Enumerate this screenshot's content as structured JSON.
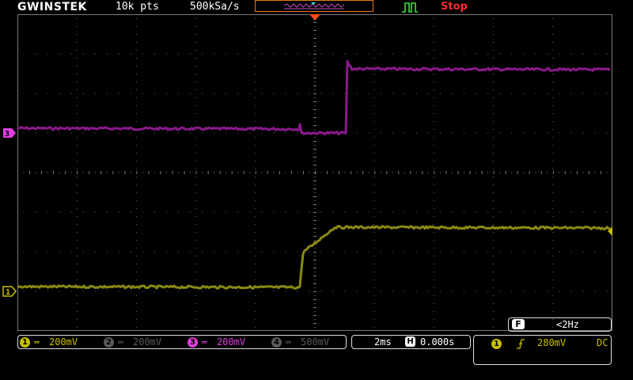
{
  "header": {
    "brand": "GWINSTEK",
    "record_length": "10k pts",
    "sample_rate": "500kSa/s",
    "acquisition_status": "Stop"
  },
  "colors": {
    "ch1": "#c8c000",
    "ch2": "#5a5a5a",
    "ch3": "#e040e0",
    "ch4": "#5a5a5a",
    "trace1": "#8a8a12",
    "trace3": "#8a1a8a",
    "status": "#ff2a2a",
    "accent": "#e57a1c",
    "trigger_icon": "#40e040"
  },
  "channels": [
    {
      "number": "1",
      "coupling": "═",
      "scale": "200mV",
      "active": true
    },
    {
      "number": "2",
      "coupling": "═",
      "scale": "200mV",
      "active": false
    },
    {
      "number": "3",
      "coupling": "═",
      "scale": "200mV",
      "active": true
    },
    {
      "number": "4",
      "coupling": "═",
      "scale": "500mV",
      "active": false
    }
  ],
  "markers": {
    "ch1_label": "1",
    "ch3_label": "3"
  },
  "timebase": {
    "scale": "2ms",
    "h_label": "H",
    "position": "0.000s"
  },
  "frequency": {
    "label": "F",
    "value": "<2Hz"
  },
  "trigger": {
    "source": "1",
    "slope": "rising-edge-icon",
    "level": "280mV",
    "coupling": "DC"
  }
}
